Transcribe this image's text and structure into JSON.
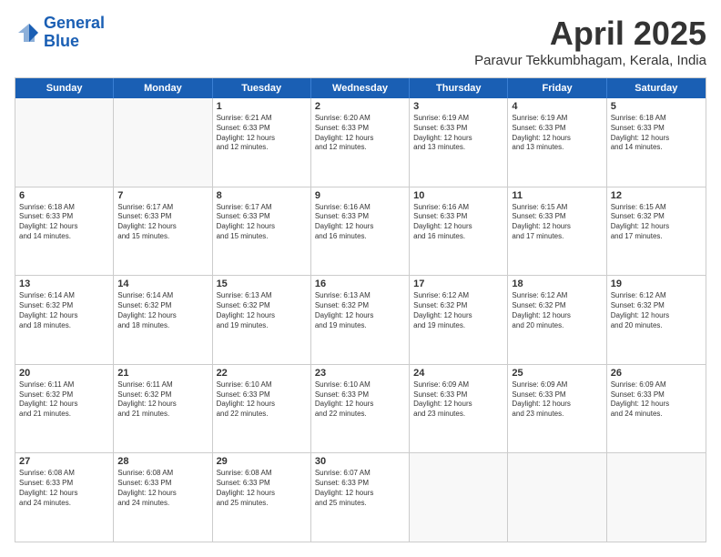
{
  "header": {
    "logo_line1": "General",
    "logo_line2": "Blue",
    "title": "April 2025",
    "subtitle": "Paravur Tekkumbhagam, Kerala, India"
  },
  "calendar": {
    "days": [
      "Sunday",
      "Monday",
      "Tuesday",
      "Wednesday",
      "Thursday",
      "Friday",
      "Saturday"
    ],
    "rows": [
      [
        {
          "day": "",
          "empty": true
        },
        {
          "day": "",
          "empty": true
        },
        {
          "day": "1",
          "sunrise": "Sunrise: 6:21 AM",
          "sunset": "Sunset: 6:33 PM",
          "daylight": "Daylight: 12 hours and 12 minutes."
        },
        {
          "day": "2",
          "sunrise": "Sunrise: 6:20 AM",
          "sunset": "Sunset: 6:33 PM",
          "daylight": "Daylight: 12 hours and 12 minutes."
        },
        {
          "day": "3",
          "sunrise": "Sunrise: 6:19 AM",
          "sunset": "Sunset: 6:33 PM",
          "daylight": "Daylight: 12 hours and 13 minutes."
        },
        {
          "day": "4",
          "sunrise": "Sunrise: 6:19 AM",
          "sunset": "Sunset: 6:33 PM",
          "daylight": "Daylight: 12 hours and 13 minutes."
        },
        {
          "day": "5",
          "sunrise": "Sunrise: 6:18 AM",
          "sunset": "Sunset: 6:33 PM",
          "daylight": "Daylight: 12 hours and 14 minutes."
        }
      ],
      [
        {
          "day": "6",
          "sunrise": "Sunrise: 6:18 AM",
          "sunset": "Sunset: 6:33 PM",
          "daylight": "Daylight: 12 hours and 14 minutes."
        },
        {
          "day": "7",
          "sunrise": "Sunrise: 6:17 AM",
          "sunset": "Sunset: 6:33 PM",
          "daylight": "Daylight: 12 hours and 15 minutes."
        },
        {
          "day": "8",
          "sunrise": "Sunrise: 6:17 AM",
          "sunset": "Sunset: 6:33 PM",
          "daylight": "Daylight: 12 hours and 15 minutes."
        },
        {
          "day": "9",
          "sunrise": "Sunrise: 6:16 AM",
          "sunset": "Sunset: 6:33 PM",
          "daylight": "Daylight: 12 hours and 16 minutes."
        },
        {
          "day": "10",
          "sunrise": "Sunrise: 6:16 AM",
          "sunset": "Sunset: 6:33 PM",
          "daylight": "Daylight: 12 hours and 16 minutes."
        },
        {
          "day": "11",
          "sunrise": "Sunrise: 6:15 AM",
          "sunset": "Sunset: 6:33 PM",
          "daylight": "Daylight: 12 hours and 17 minutes."
        },
        {
          "day": "12",
          "sunrise": "Sunrise: 6:15 AM",
          "sunset": "Sunset: 6:32 PM",
          "daylight": "Daylight: 12 hours and 17 minutes."
        }
      ],
      [
        {
          "day": "13",
          "sunrise": "Sunrise: 6:14 AM",
          "sunset": "Sunset: 6:32 PM",
          "daylight": "Daylight: 12 hours and 18 minutes."
        },
        {
          "day": "14",
          "sunrise": "Sunrise: 6:14 AM",
          "sunset": "Sunset: 6:32 PM",
          "daylight": "Daylight: 12 hours and 18 minutes."
        },
        {
          "day": "15",
          "sunrise": "Sunrise: 6:13 AM",
          "sunset": "Sunset: 6:32 PM",
          "daylight": "Daylight: 12 hours and 19 minutes."
        },
        {
          "day": "16",
          "sunrise": "Sunrise: 6:13 AM",
          "sunset": "Sunset: 6:32 PM",
          "daylight": "Daylight: 12 hours and 19 minutes."
        },
        {
          "day": "17",
          "sunrise": "Sunrise: 6:12 AM",
          "sunset": "Sunset: 6:32 PM",
          "daylight": "Daylight: 12 hours and 19 minutes."
        },
        {
          "day": "18",
          "sunrise": "Sunrise: 6:12 AM",
          "sunset": "Sunset: 6:32 PM",
          "daylight": "Daylight: 12 hours and 20 minutes."
        },
        {
          "day": "19",
          "sunrise": "Sunrise: 6:12 AM",
          "sunset": "Sunset: 6:32 PM",
          "daylight": "Daylight: 12 hours and 20 minutes."
        }
      ],
      [
        {
          "day": "20",
          "sunrise": "Sunrise: 6:11 AM",
          "sunset": "Sunset: 6:32 PM",
          "daylight": "Daylight: 12 hours and 21 minutes."
        },
        {
          "day": "21",
          "sunrise": "Sunrise: 6:11 AM",
          "sunset": "Sunset: 6:32 PM",
          "daylight": "Daylight: 12 hours and 21 minutes."
        },
        {
          "day": "22",
          "sunrise": "Sunrise: 6:10 AM",
          "sunset": "Sunset: 6:33 PM",
          "daylight": "Daylight: 12 hours and 22 minutes."
        },
        {
          "day": "23",
          "sunrise": "Sunrise: 6:10 AM",
          "sunset": "Sunset: 6:33 PM",
          "daylight": "Daylight: 12 hours and 22 minutes."
        },
        {
          "day": "24",
          "sunrise": "Sunrise: 6:09 AM",
          "sunset": "Sunset: 6:33 PM",
          "daylight": "Daylight: 12 hours and 23 minutes."
        },
        {
          "day": "25",
          "sunrise": "Sunrise: 6:09 AM",
          "sunset": "Sunset: 6:33 PM",
          "daylight": "Daylight: 12 hours and 23 minutes."
        },
        {
          "day": "26",
          "sunrise": "Sunrise: 6:09 AM",
          "sunset": "Sunset: 6:33 PM",
          "daylight": "Daylight: 12 hours and 24 minutes."
        }
      ],
      [
        {
          "day": "27",
          "sunrise": "Sunrise: 6:08 AM",
          "sunset": "Sunset: 6:33 PM",
          "daylight": "Daylight: 12 hours and 24 minutes."
        },
        {
          "day": "28",
          "sunrise": "Sunrise: 6:08 AM",
          "sunset": "Sunset: 6:33 PM",
          "daylight": "Daylight: 12 hours and 24 minutes."
        },
        {
          "day": "29",
          "sunrise": "Sunrise: 6:08 AM",
          "sunset": "Sunset: 6:33 PM",
          "daylight": "Daylight: 12 hours and 25 minutes."
        },
        {
          "day": "30",
          "sunrise": "Sunrise: 6:07 AM",
          "sunset": "Sunset: 6:33 PM",
          "daylight": "Daylight: 12 hours and 25 minutes."
        },
        {
          "day": "",
          "empty": true
        },
        {
          "day": "",
          "empty": true
        },
        {
          "day": "",
          "empty": true
        }
      ]
    ]
  }
}
